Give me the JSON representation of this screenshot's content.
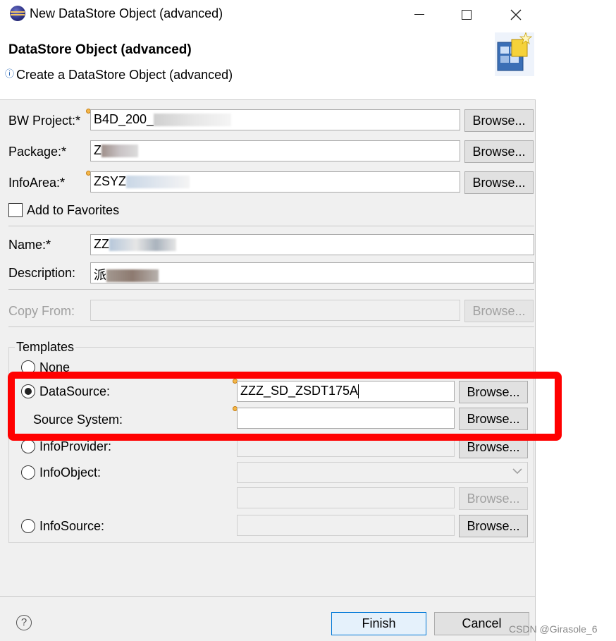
{
  "window": {
    "title": "New DataStore Object (advanced)"
  },
  "header": {
    "title": "DataStore Object (advanced)",
    "description": "Create a DataStore Object (advanced)"
  },
  "form": {
    "bw_project": {
      "label": "BW Project:*",
      "value": "B4D_200_",
      "browse": "Browse..."
    },
    "package": {
      "label": "Package:*",
      "value": "Z",
      "browse": "Browse..."
    },
    "info_area": {
      "label": "InfoArea:*",
      "value": "ZSYZ",
      "browse": "Browse..."
    },
    "add_to_favorites": {
      "label": "Add to Favorites",
      "checked": false
    },
    "name": {
      "label": "Name:*",
      "value": "ZZ"
    },
    "description": {
      "label": "Description:",
      "value": "派"
    },
    "copy_from": {
      "label": "Copy From:",
      "value": "",
      "browse": "Browse..."
    }
  },
  "templates": {
    "label": "Templates",
    "selected": "DataSource",
    "none": {
      "label": "None"
    },
    "datasource": {
      "label": "DataSource:",
      "value": "ZZZ_SD_ZSDT175A",
      "browse": "Browse..."
    },
    "source_system": {
      "label": "Source System:",
      "value": "",
      "browse": "Browse..."
    },
    "infoprovider": {
      "label": "InfoProvider:",
      "value": "",
      "browse": "Browse..."
    },
    "infoobject": {
      "label": "InfoObject:",
      "value": "",
      "browse": "Browse..."
    },
    "infosource": {
      "label": "InfoSource:",
      "value": "",
      "browse": "Browse..."
    }
  },
  "footer": {
    "help": "?",
    "finish": "Finish",
    "cancel": "Cancel"
  },
  "watermark": "CSDN @Girasole_6",
  "colors": {
    "highlight": "#ff0000",
    "primary_button_border": "#0078d7"
  }
}
